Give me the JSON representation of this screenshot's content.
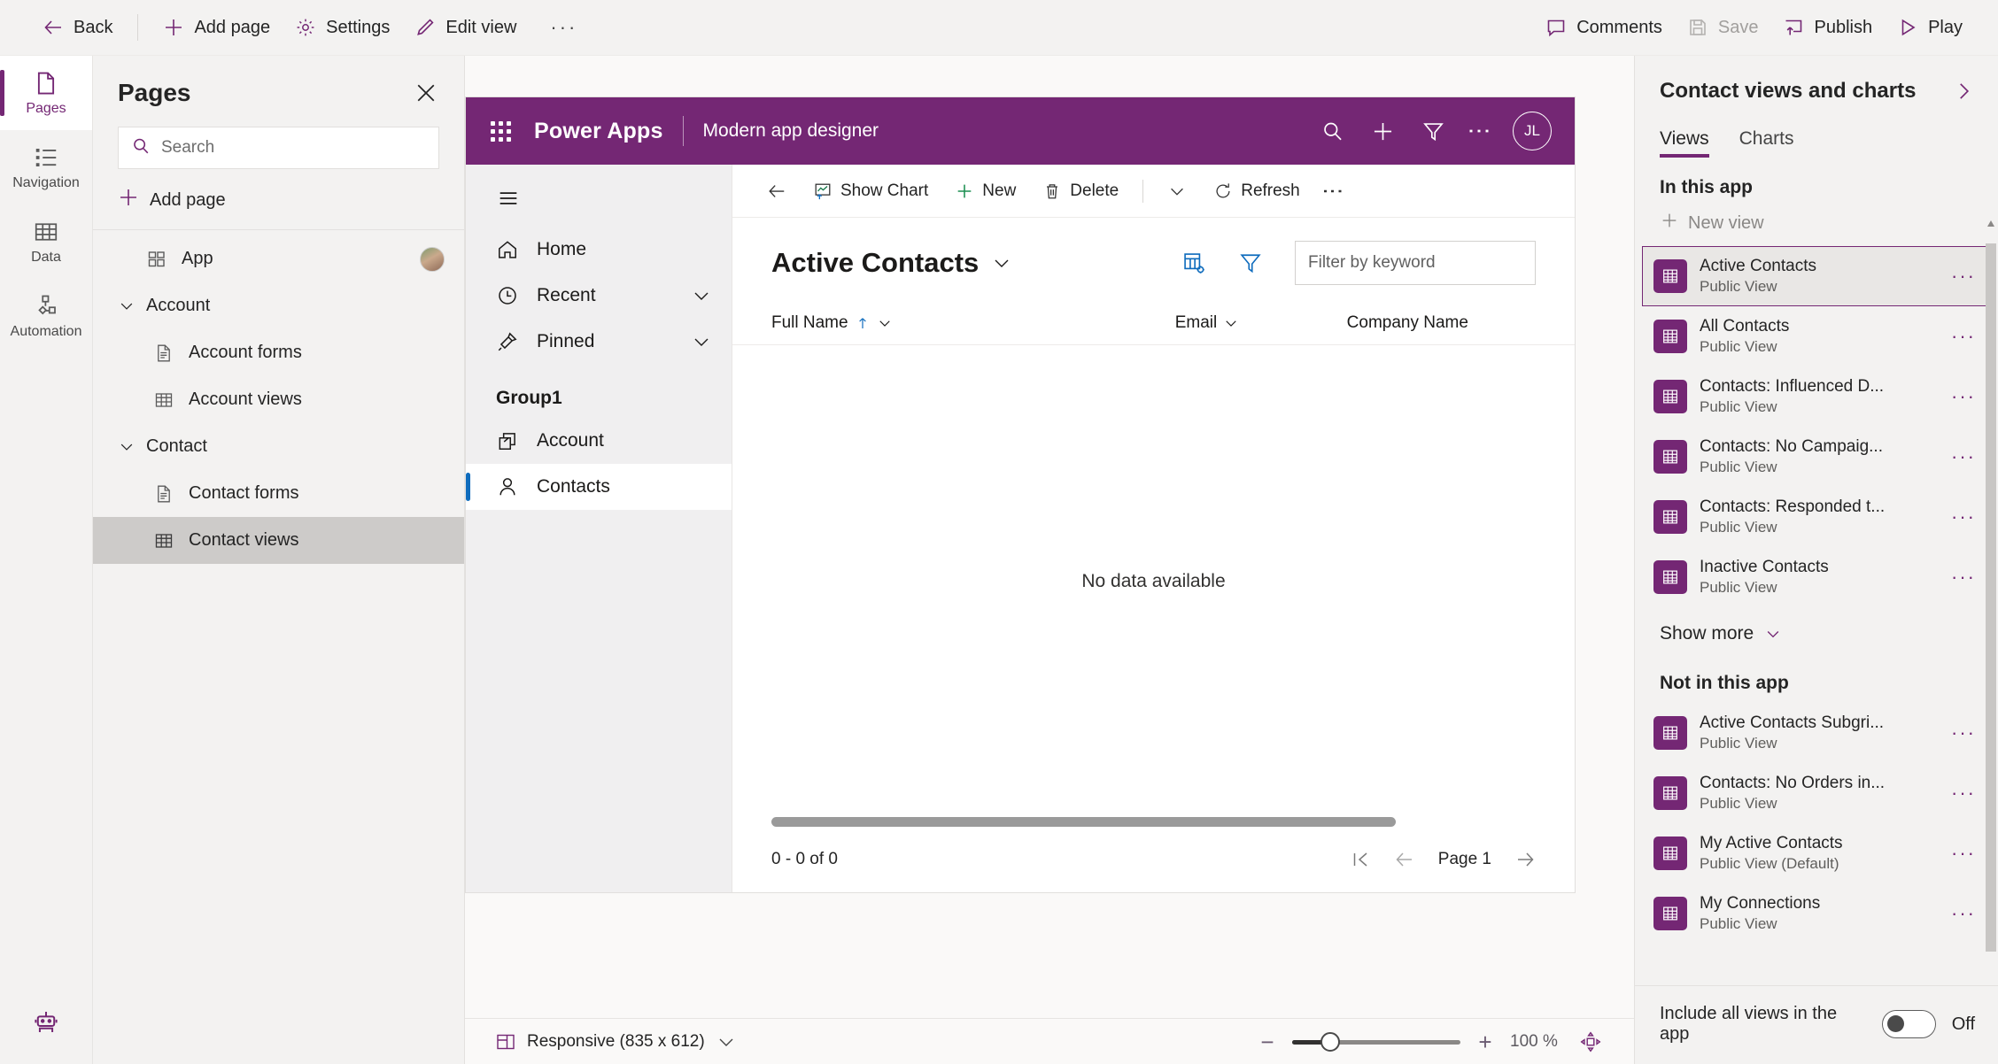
{
  "topbar": {
    "left_items": [
      {
        "label": "Back",
        "icon": "arrow-left-icon"
      },
      {
        "label": "Add page",
        "icon": "plus-icon"
      },
      {
        "label": "Settings",
        "icon": "gear-icon"
      },
      {
        "label": "Edit view",
        "icon": "pencil-icon"
      },
      {
        "label": "···",
        "icon": "overflow-icon"
      }
    ],
    "right_items": [
      {
        "label": "Comments",
        "icon": "comment-icon",
        "disabled": false
      },
      {
        "label": "Save",
        "icon": "save-icon",
        "disabled": true
      },
      {
        "label": "Publish",
        "icon": "publish-icon",
        "disabled": false
      },
      {
        "label": "Play",
        "icon": "play-icon",
        "disabled": false
      }
    ]
  },
  "rail": {
    "items": [
      {
        "label": "Pages",
        "icon": "page-icon",
        "active": true
      },
      {
        "label": "Navigation",
        "icon": "navigation-list-icon",
        "active": false
      },
      {
        "label": "Data",
        "icon": "table-icon",
        "active": false
      },
      {
        "label": "Automation",
        "icon": "automation-flow-icon",
        "active": false
      }
    ],
    "bottom_icon": "copilot-robot-icon"
  },
  "pages_panel": {
    "title": "Pages",
    "close_icon": "close-icon",
    "search_placeholder": "Search",
    "search_value": "",
    "add_page_label": "Add page",
    "tree": [
      {
        "label": "App",
        "icon": "app-grid-icon",
        "level": 0,
        "avatar": true,
        "selected": false
      },
      {
        "label": "Account",
        "icon": "chevron-down-icon",
        "level": 0,
        "group": true,
        "selected": false
      },
      {
        "label": "Account forms",
        "icon": "form-icon",
        "level": 1,
        "selected": false
      },
      {
        "label": "Account views",
        "icon": "table-icon",
        "level": 1,
        "selected": false
      },
      {
        "label": "Contact",
        "icon": "chevron-down-icon",
        "level": 0,
        "group": true,
        "selected": false
      },
      {
        "label": "Contact forms",
        "icon": "form-icon",
        "level": 1,
        "selected": false
      },
      {
        "label": "Contact views",
        "icon": "table-icon",
        "level": 1,
        "selected": true
      }
    ]
  },
  "canvas": {
    "app_header": {
      "waffle_icon": "waffle-icon",
      "brand": "Power Apps",
      "subtitle": "Modern app designer",
      "actions": [
        {
          "icon": "search-icon"
        },
        {
          "icon": "plus-icon"
        },
        {
          "icon": "filter-icon"
        },
        {
          "icon": "more-vertical-icon"
        }
      ],
      "avatar_initials": "JL"
    },
    "sitemap": {
      "hamburger_icon": "hamburger-icon",
      "items": [
        {
          "label": "Home",
          "icon": "home-icon",
          "chevron": false,
          "active": false
        },
        {
          "label": "Recent",
          "icon": "clock-icon",
          "chevron": true,
          "active": false
        },
        {
          "label": "Pinned",
          "icon": "pin-icon",
          "chevron": true,
          "active": false
        }
      ],
      "group_label": "Group1",
      "group_items": [
        {
          "label": "Account",
          "icon": "account-icon",
          "active": false
        },
        {
          "label": "Contacts",
          "icon": "contact-person-icon",
          "active": true
        }
      ]
    },
    "commandbar": {
      "back_icon": "arrow-left-icon",
      "buttons": [
        {
          "label": "Show Chart",
          "icon": "show-chart-icon"
        },
        {
          "label": "New",
          "icon": "plus-green-icon"
        },
        {
          "label": "Delete",
          "icon": "trash-icon"
        }
      ],
      "chevron_icon": "chevron-down-icon",
      "refresh_label": "Refresh",
      "refresh_icon": "refresh-icon",
      "overflow_icon": "more-vertical-icon"
    },
    "view": {
      "title": "Active Contacts",
      "title_chevron_icon": "chevron-down-icon",
      "edit_columns_icon": "edit-columns-icon",
      "filter_icon": "filter-icon",
      "keyword_placeholder": "Filter by keyword",
      "keyword_value": ""
    },
    "grid": {
      "columns": [
        {
          "label": "Full Name",
          "sorted": true,
          "sort_icon": "sort-asc-icon",
          "chevron": true
        },
        {
          "label": "Email",
          "sorted": false,
          "chevron": true
        },
        {
          "label": "Company Name",
          "sorted": false,
          "chevron": false
        }
      ],
      "empty_message": "No data available",
      "record_count": "0 - 0 of 0",
      "page_label": "Page 1",
      "pager_icons": [
        "first-page-icon",
        "previous-page-icon",
        "next-page-icon"
      ]
    }
  },
  "statusbar": {
    "responsive_icon": "responsive-icon",
    "responsive_label": "Responsive (835 x 612)",
    "responsive_chevron": "chevron-down-icon",
    "zoom_out_icon": "minus-icon",
    "zoom_in_icon": "plus-icon",
    "zoom_value": "100 %",
    "fit_icon": "fit-to-screen-icon"
  },
  "right_panel": {
    "title": "Contact views and charts",
    "expand_icon": "chevron-right-icon",
    "tabs": [
      {
        "label": "Views",
        "active": true
      },
      {
        "label": "Charts",
        "active": false
      }
    ],
    "section_in_app": "In this app",
    "new_view_label": "New view",
    "new_view_icon": "plus-icon",
    "views_in_app": [
      {
        "name": "Active Contacts",
        "subtitle": "Public View",
        "icon": "view-table-icon",
        "selected": true
      },
      {
        "name": "All Contacts",
        "subtitle": "Public View",
        "icon": "view-table-icon",
        "selected": false
      },
      {
        "name": "Contacts: Influenced D...",
        "subtitle": "Public View",
        "icon": "view-table-icon",
        "selected": false
      },
      {
        "name": "Contacts: No Campaig...",
        "subtitle": "Public View",
        "icon": "view-table-icon",
        "selected": false
      },
      {
        "name": "Contacts: Responded t...",
        "subtitle": "Public View",
        "icon": "view-table-icon",
        "selected": false
      },
      {
        "name": "Inactive Contacts",
        "subtitle": "Public View",
        "icon": "view-table-icon",
        "selected": false
      }
    ],
    "show_more_label": "Show more",
    "show_more_icon": "chevron-down-icon",
    "section_not_in_app": "Not in this app",
    "views_not_in_app": [
      {
        "name": "Active Contacts Subgri...",
        "subtitle": "Public View",
        "icon": "view-table-icon"
      },
      {
        "name": "Contacts: No Orders in...",
        "subtitle": "Public View",
        "icon": "view-table-icon"
      },
      {
        "name": "My Active Contacts",
        "subtitle": "Public View (Default)",
        "icon": "view-table-icon"
      },
      {
        "name": "My Connections",
        "subtitle": "Public View",
        "icon": "view-table-icon"
      }
    ],
    "more_menu_glyph": "···",
    "footer_label": "Include all views in the app",
    "footer_toggle_state": "Off"
  }
}
